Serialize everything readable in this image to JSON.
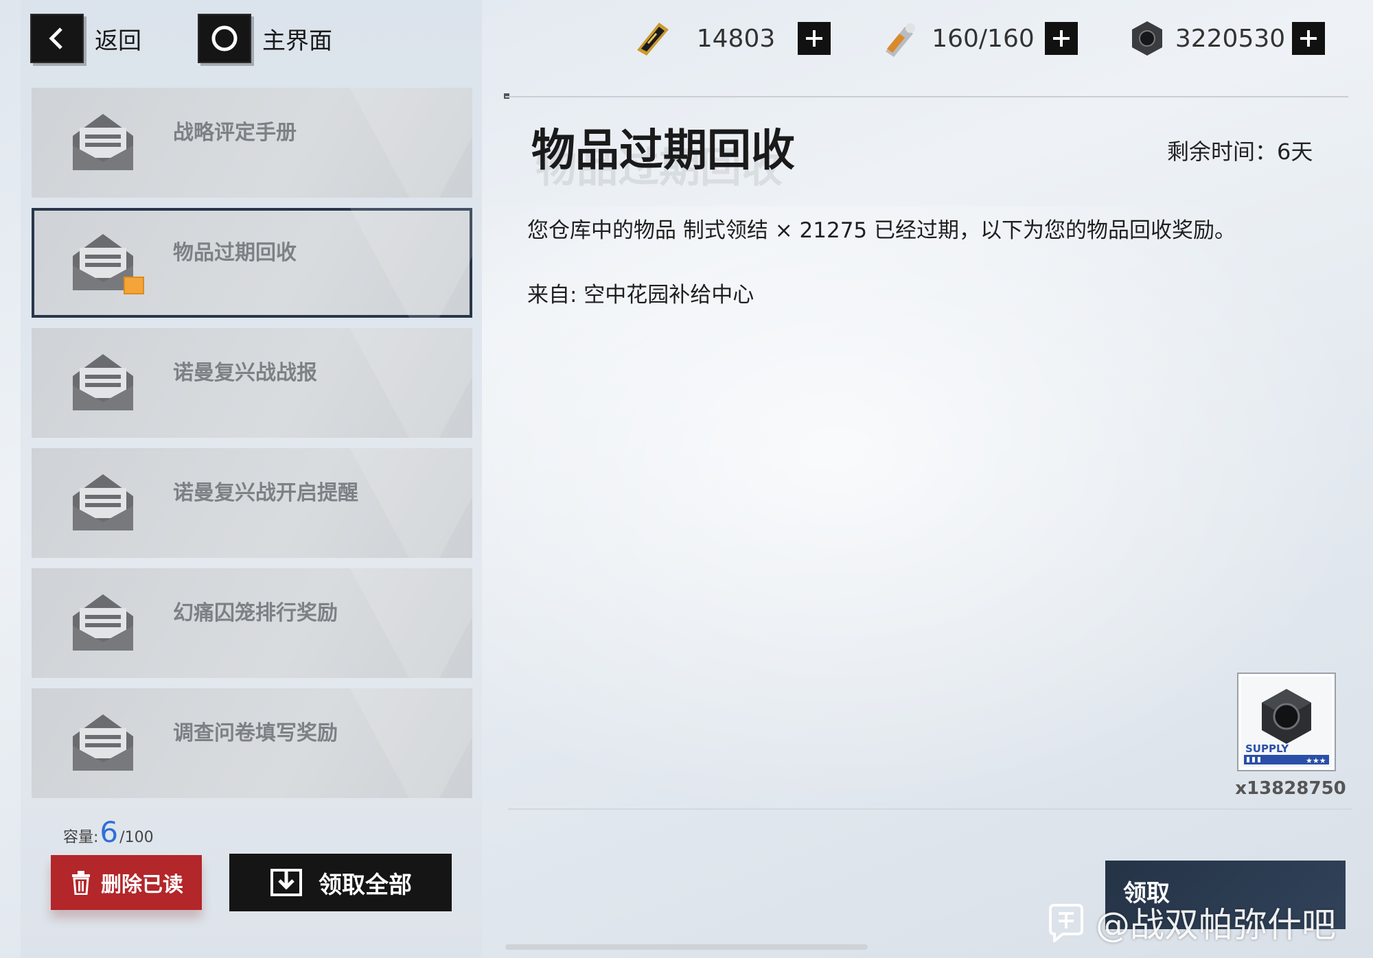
{
  "nav": {
    "back_label": "返回",
    "home_label": "主界面"
  },
  "resources": [
    {
      "icon": "gold-ticket-icon",
      "value": "14803"
    },
    {
      "icon": "ammo-icon",
      "value": "160/160"
    },
    {
      "icon": "hex-nut-icon",
      "value": "3220530"
    }
  ],
  "mails": [
    {
      "label": "战略评定手册"
    },
    {
      "label": "物品过期回收",
      "selected": true,
      "has_attachment": true
    },
    {
      "label": "诺曼复兴战战报"
    },
    {
      "label": "诺曼复兴战开启提醒"
    },
    {
      "label": "幻痛囚笼排行奖励"
    },
    {
      "label": "调查问卷填写奖励"
    }
  ],
  "capacity": {
    "label": "容量:",
    "current": "6",
    "max": "/100"
  },
  "buttons": {
    "delete_read": "删除已读",
    "claim_all": "领取全部",
    "claim": "领取"
  },
  "detail": {
    "title": "物品过期回收",
    "remaining": "剩余时间：6天",
    "body": "您仓库中的物品 制式领结 × 21275 已经过期，以下为您的物品回收奖励。",
    "from": "来自: 空中花园补给中心",
    "reward": {
      "icon": "hex-nut-icon",
      "tag": "SUPPLY",
      "qty": "x13828750"
    }
  },
  "watermark": "@战双帕弥什吧"
}
